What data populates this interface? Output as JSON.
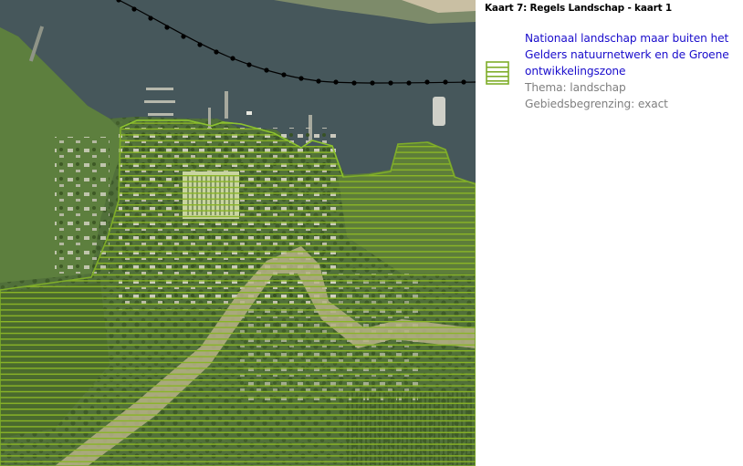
{
  "legend": {
    "title": "Kaart 7: Regels Landschap - kaart 1",
    "items": [
      {
        "label": "Nationaal landschap maar buiten het Gelders natuurnetwerk en de Groene ontwikkelingszone",
        "theme": "Thema: landschap",
        "boundary": "Gebiedsbegrenzing: exact",
        "color": "#7fad2a",
        "symbol": "hatch-horizontal"
      }
    ]
  },
  "colors": {
    "water": "#45555a",
    "land": "#4f6a35",
    "hatch": "#7fad2a",
    "legend_link": "#1a0dcc",
    "legend_meta": "#7f7f7f"
  }
}
